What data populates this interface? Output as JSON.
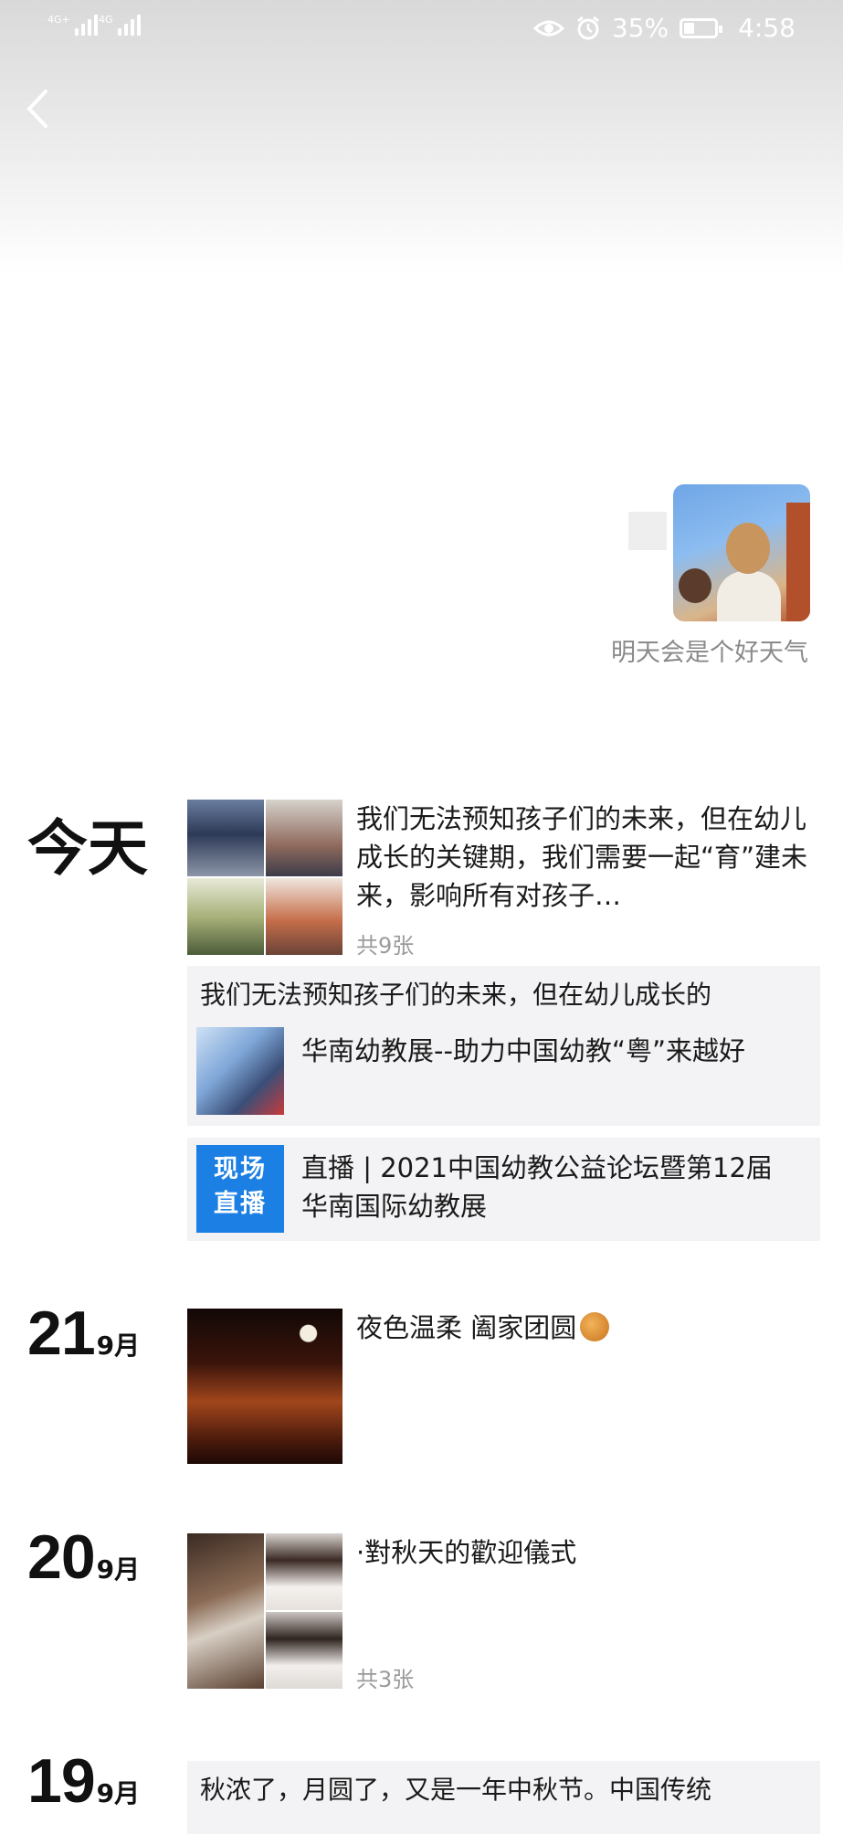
{
  "status_bar": {
    "signal1_label": "4G+",
    "signal2_label": "4G",
    "battery_percent": "35%",
    "battery_level": 0.35,
    "time": "4:58"
  },
  "profile": {
    "signature": "明天会是个好天气"
  },
  "posts": [
    {
      "day_label": "今天",
      "text": "我们无法预知孩子们的未来，但在幼儿成长的关键期，我们需要一起“育”建未来，影响所有对孩子…",
      "photo_count": "共9张",
      "shares": [
        {
          "title": "我们无法预知孩子们的未来，但在幼儿成长的",
          "text": "华南幼教展--助力中国幼教“粤”来越好"
        },
        {
          "badge_line1": "现场",
          "badge_line2": "直播",
          "text": "直播 | 2021中国幼教公益论坛暨第12届华南国际幼教展"
        }
      ]
    },
    {
      "day": "21",
      "month": "9月",
      "text": "夜色温柔  阖家团圆"
    },
    {
      "day": "20",
      "month": "9月",
      "text": "·對秋天的歡迎儀式",
      "photo_count": "共3张"
    },
    {
      "day": "19",
      "month": "9月",
      "text": "秋浓了，月圆了，又是一年中秋节。中国传统"
    }
  ]
}
